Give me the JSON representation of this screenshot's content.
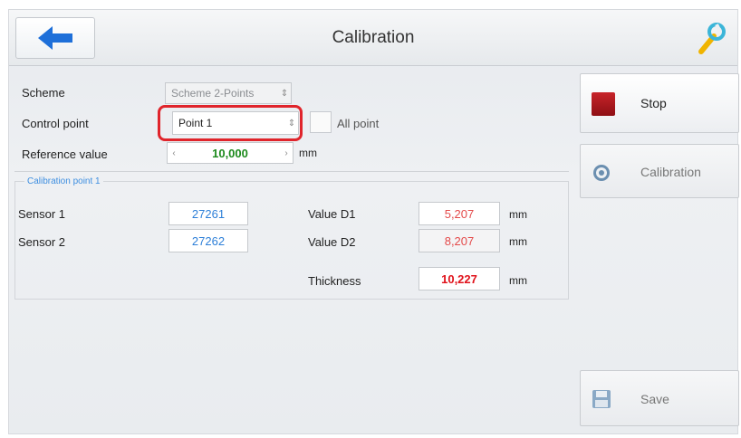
{
  "header": {
    "title": "Calibration",
    "back_icon": "arrow-left-icon",
    "tool_icon": "wrench-icon"
  },
  "form": {
    "scheme_label": "Scheme",
    "scheme_value": "Scheme 2-Points",
    "control_point_label": "Control point",
    "control_point_value": "Point 1",
    "all_point_label": "All point",
    "reference_label": "Reference value",
    "reference_value": "10,000",
    "reference_unit": "mm"
  },
  "calibration_point": {
    "legend": "Calibration point 1",
    "sensor1_label": "Sensor 1",
    "sensor1_value": "27261",
    "sensor2_label": "Sensor 2",
    "sensor2_value": "27262",
    "d1_label": "Value D1",
    "d1_value": "5,207",
    "d1_unit": "mm",
    "d2_label": "Value D2",
    "d2_value": "8,207",
    "d2_unit": "mm",
    "thickness_label": "Thickness",
    "thickness_value": "10,227",
    "thickness_unit": "mm"
  },
  "side": {
    "stop_label": "Stop",
    "calibration_label": "Calibration",
    "save_label": "Save"
  },
  "colors": {
    "back_arrow": "#1e6fd9",
    "stop": "#b31a20",
    "highlight": "#e0242b",
    "sensor_text": "#2d7fd8",
    "value_text": "#e44a4a",
    "reference_text": "#1c8a1c"
  }
}
